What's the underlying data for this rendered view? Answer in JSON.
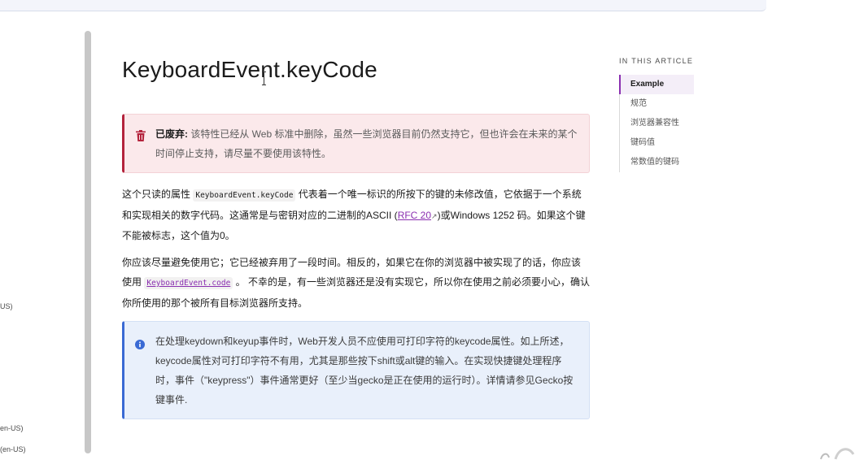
{
  "sidebar_fragments": [
    "US)",
    "en-US)",
    "(en-US)"
  ],
  "article": {
    "title": "KeyboardEvent.keyCode",
    "deprecated": {
      "label": "已废弃:",
      "text": " 该特性已经从 Web 标准中删除，虽然一些浏览器目前仍然支持它，但也许会在未来的某个时间停止支持，请尽量不要使用该特性。"
    },
    "para1": {
      "t1": "这个只读的属性 ",
      "code": "KeyboardEvent.keyCode",
      "t2": " 代表着一个唯一标识的所按下的键的未修改值，它依据于一个系统和实现相关的数字代码。这通常是与密钥对应的二进制的ASCII (",
      "link": "RFC 20",
      "ext": "↗",
      "t3": ")或Windows 1252 码。如果这个键不能被标志，这个值为0。"
    },
    "para2": {
      "t1": "你应该尽量避免使用它；它已经被弃用了一段时间。相反的，如果它在你的浏览器中被实现了的话，你应该使用 ",
      "code": "KeyboardEvent.code",
      "t2": " 。 不幸的是，有一些浏览器还是没有实现它，所以你在使用之前必须要小心，确认你所使用的那个被所有目标浏览器所支持。"
    },
    "info_note": "在处理keydown和keyup事件时，Web开发人员不应使用可打印字符的keycode属性。如上所述，keycode属性对可打印字符不有用，尤其是那些按下shift或alt键的输入。在实现快捷键处理程序时，事件（\"keypress\"）事件通常更好（至少当gecko是正在使用的运行时）。详情请参见Gecko按键事件."
  },
  "toc": {
    "heading": "IN THIS ARTICLE",
    "items": [
      {
        "label": "Example",
        "active": true
      },
      {
        "label": "规范",
        "active": false
      },
      {
        "label": "浏览器兼容性",
        "active": false
      },
      {
        "label": "键码值",
        "active": false
      },
      {
        "label": "常数值的键码",
        "active": false
      }
    ]
  },
  "colors": {
    "deprecated_accent": "#b4233c",
    "info_accent": "#3a6ad4",
    "link": "#8a2fb0",
    "toc_active_bg": "#f4eef8"
  },
  "icons": {
    "deprecated": "trash-icon",
    "info": "info-circle-icon",
    "external_link": "external-link-icon"
  }
}
